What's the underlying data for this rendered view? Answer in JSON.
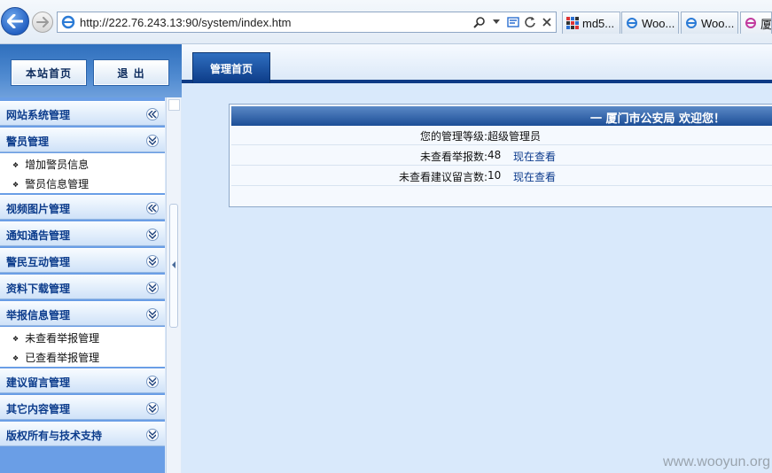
{
  "browser": {
    "url": "http://222.76.243.13:90/system/index.htm",
    "tabs": [
      {
        "label": "md5..."
      },
      {
        "label": "Woo..."
      },
      {
        "label": "Woo..."
      },
      {
        "label": "厦"
      }
    ]
  },
  "sidebar": {
    "home_button": "本站首页",
    "logout_button": "退  出",
    "groups": [
      {
        "label": "网站系统管理",
        "items": []
      },
      {
        "label": "警员管理",
        "items": [
          "增加警员信息",
          "警员信息管理"
        ]
      },
      {
        "label": "视频图片管理",
        "items": []
      },
      {
        "label": "通知通告管理",
        "items": []
      },
      {
        "label": "警民互动管理",
        "items": []
      },
      {
        "label": "资料下载管理",
        "items": []
      },
      {
        "label": "举报信息管理",
        "items": [
          "未查看举报管理",
          "已查看举报管理"
        ]
      },
      {
        "label": "建议留言管理",
        "items": []
      },
      {
        "label": "其它内容管理",
        "items": []
      },
      {
        "label": "版权所有与技术支持",
        "items": []
      }
    ]
  },
  "main": {
    "tab_label": "管理首页",
    "panel": {
      "title": "一 厦门市公安局 欢迎您！",
      "rows": [
        {
          "label": "您的管理等级:",
          "value": "超级管理员",
          "link": ""
        },
        {
          "label": "未查看举报数:",
          "value": "48",
          "link": "现在查看"
        },
        {
          "label": "未查看建议留言数:",
          "value": "10",
          "link": "现在查看"
        }
      ]
    }
  },
  "watermark": "www.wooyun.org",
  "colors": {
    "accent_dark_blue": "#0e3a85",
    "menu_text": "#0c3c8c",
    "content_bg": "#d9e9fb"
  }
}
